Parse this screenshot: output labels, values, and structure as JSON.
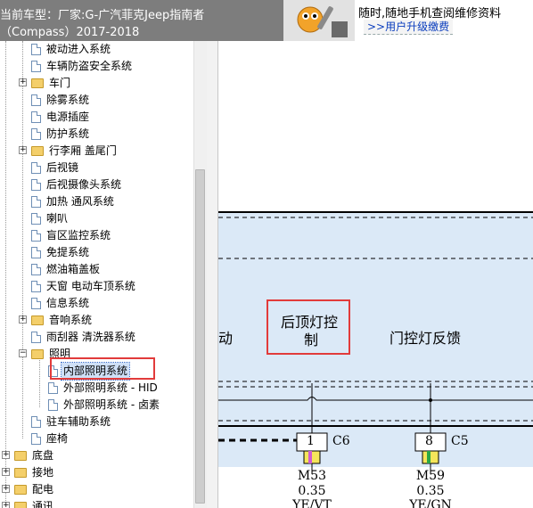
{
  "header": {
    "line1": "当前车型：厂家:G-广汽菲克Jeep指南者",
    "line2": "（Compass）2017-2018",
    "ad_text": "随时,随地手机查阅维修资料",
    "ad_link": ">>用户升级缴费"
  },
  "tree": {
    "items": [
      {
        "label": "被动进入系统"
      },
      {
        "label": "车辆防盗安全系统"
      },
      {
        "label": "车门"
      },
      {
        "label": "除雾系统"
      },
      {
        "label": "电源插座"
      },
      {
        "label": "防护系统"
      },
      {
        "label": "行李厢 盖尾门"
      },
      {
        "label": "后视镜"
      },
      {
        "label": "后视摄像头系统"
      },
      {
        "label": "加热 通风系统"
      },
      {
        "label": "喇叭"
      },
      {
        "label": "盲区监控系统"
      },
      {
        "label": "免提系统"
      },
      {
        "label": "燃油箱盖板"
      },
      {
        "label": "天窗 电动车顶系统"
      },
      {
        "label": "信息系统"
      },
      {
        "label": "音响系统"
      },
      {
        "label": "雨刮器 清洗器系统"
      },
      {
        "label": "照明"
      },
      {
        "label": "内部照明系统"
      },
      {
        "label": "外部照明系统 - HID"
      },
      {
        "label": "外部照明系统 - 卤素"
      },
      {
        "label": "驻车辅助系统"
      },
      {
        "label": "座椅"
      },
      {
        "label": "底盘"
      },
      {
        "label": "接地"
      },
      {
        "label": "配电"
      },
      {
        "label": "通讯"
      }
    ]
  },
  "diagram": {
    "left_label": "动",
    "center_label_1": "后顶灯控",
    "center_label_2": "制",
    "right_label": "门控灯反馈",
    "connectors": [
      {
        "pin": "1",
        "name": "C6",
        "wire_id": "M53",
        "gauge": "0.35",
        "color": "YE/VT"
      },
      {
        "pin": "8",
        "name": "C5",
        "wire_id": "M59",
        "gauge": "0.35",
        "color": "YE/GN"
      }
    ]
  },
  "colors": {
    "header_bg": "#7d7d7d",
    "band_bg": "#dbe9f7",
    "highlight": "#e23b3b",
    "link": "#0a3dbd"
  }
}
